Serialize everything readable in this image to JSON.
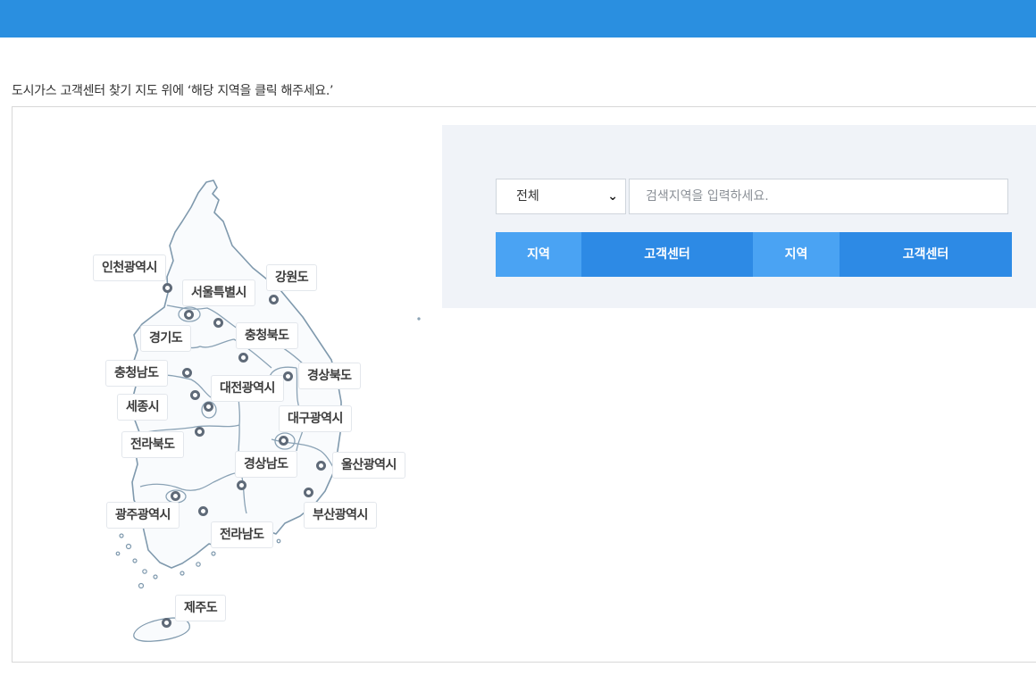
{
  "header": {
    "accent_color": "#2a8fe0"
  },
  "instruction": "도시가스 고객센터 찾기 지도 위에 ‘해당 지역을 클릭 해주세요.’",
  "map": {
    "regions": [
      {
        "id": "incheon",
        "label": "인천광역시"
      },
      {
        "id": "gangwon",
        "label": "강원도"
      },
      {
        "id": "seoul",
        "label": "서울특별시"
      },
      {
        "id": "gyeonggi",
        "label": "경기도"
      },
      {
        "id": "chungbuk",
        "label": "충청북도"
      },
      {
        "id": "chungnam",
        "label": "충청남도"
      },
      {
        "id": "gyeongbuk",
        "label": "경상북도"
      },
      {
        "id": "daejeon",
        "label": "대전광역시"
      },
      {
        "id": "sejong",
        "label": "세종시"
      },
      {
        "id": "daegu",
        "label": "대구광역시"
      },
      {
        "id": "jeonbuk",
        "label": "전라북도"
      },
      {
        "id": "gyeongnam",
        "label": "경상남도"
      },
      {
        "id": "ulsan",
        "label": "울산광역시"
      },
      {
        "id": "gwangju",
        "label": "광주광역시"
      },
      {
        "id": "busan",
        "label": "부산광역시"
      },
      {
        "id": "jeonnam",
        "label": "전라남도"
      },
      {
        "id": "jeju",
        "label": "제주도"
      }
    ]
  },
  "search": {
    "select_value": "전체",
    "input_value": "",
    "input_placeholder": "검색지역을 입력하세요."
  },
  "table": {
    "headers": [
      "지역",
      "고객센터",
      "지역",
      "고객센터"
    ]
  }
}
